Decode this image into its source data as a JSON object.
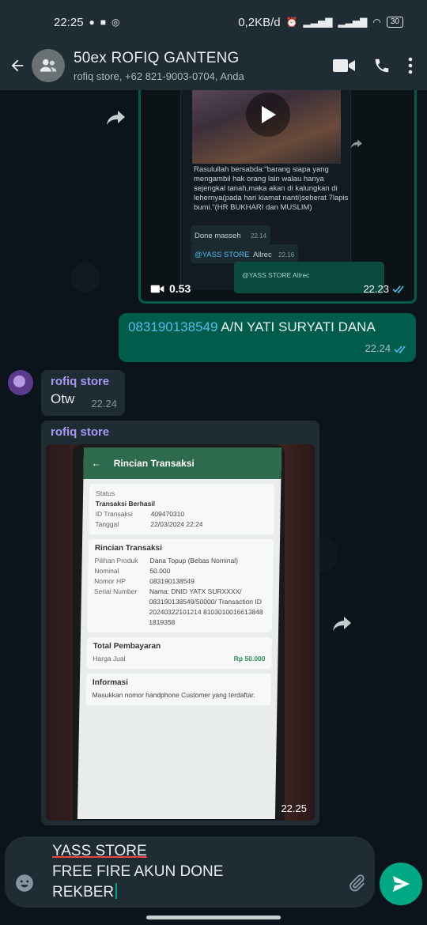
{
  "status_bar": {
    "time": "22:25",
    "network_speed": "0,2KB/d",
    "battery": "30"
  },
  "header": {
    "title": "50ex ROFIQ GANTENG",
    "subtitle": "rofiq store, +62 821-9003-0704, Anda",
    "icons": [
      "back-arrow-icon",
      "group-avatar-icon",
      "video-call-icon",
      "voice-call-icon",
      "more-options-icon"
    ]
  },
  "messages": [
    {
      "type": "video",
      "direction": "outgoing",
      "duration": "0.53",
      "time": "22.23",
      "status": "read",
      "embedded": {
        "quote": "Rasulullah bersabda:\"barang siapa yang mengambil hak orang lain walau hanya sejengkal tanah,maka akan di kalungkan di lehernya(pada hari kiamat nanti)seberat 7lapis bumi.\"(HR BUKHARI dan MUSLIM)",
        "done": "Done masseh",
        "done_time": "22.14",
        "mention": "@YASS STORE",
        "mention_text": "Allrec",
        "mention_time": "22.16",
        "reply_mention": "@YASS STORE Allrec"
      }
    },
    {
      "type": "text",
      "direction": "outgoing",
      "link": "083190138549",
      "text": " A/N YATI SURYATI DANA",
      "time": "22.24",
      "status": "read"
    },
    {
      "type": "text",
      "direction": "incoming",
      "sender": "rofiq store",
      "text": "Otw",
      "time": "22.24"
    },
    {
      "type": "image",
      "direction": "incoming",
      "sender": "rofiq store",
      "time": "22.25",
      "photo": {
        "screen_title": "Rincian Transaksi",
        "status_label": "Status",
        "status_value": "Transaksi Berhasil",
        "id_label": "ID Transaksi",
        "id_value": "409470310",
        "date_label": "Tanggal",
        "date_value": "22/03/2024 22:24",
        "section_detail": "Rincian Transaksi",
        "product_label": "Pilihan Produk",
        "product_value": "Dana Topup (Bebas Nominal)",
        "nominal_label": "Nominal",
        "nominal_value": "50.000",
        "phone_label": "Nomor HP",
        "phone_value": "083190138549",
        "serial_label": "Serial Number",
        "serial_value": "Nama: DNID YATX SURXXXX/ 083190138549/50000/ Transaction ID 20240322101214 8103010016613848 1819358",
        "total_section": "Total Pembayaran",
        "price_label": "Harga Jual",
        "price_value": "Rp 50.000",
        "info_section": "Informasi",
        "info_text": "Masukkan nomor handphone Customer yang terdaftar."
      }
    }
  ],
  "composer": {
    "line1": "YASS STORE",
    "line2": "FREE FIRE AKUN DONE",
    "line3": "REKBER"
  }
}
